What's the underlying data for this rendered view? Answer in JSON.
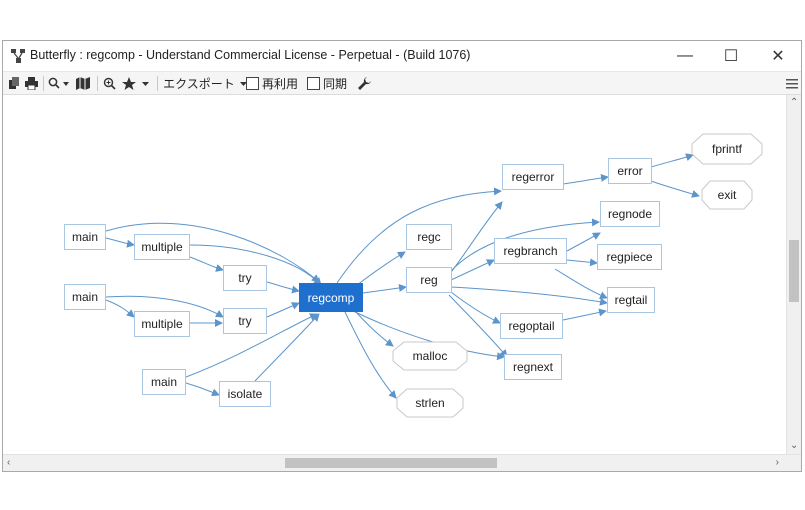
{
  "window": {
    "title": "Butterfly : regcomp - Understand Commercial License - Perpetual - (Build 1076)",
    "minimize_glyph": "—",
    "maximize_glyph": "☐",
    "close_glyph": "✕"
  },
  "toolbar": {
    "export_label": "エクスポート",
    "reuse_label": "再利用",
    "sync_label": "同期",
    "reuse_checked": false,
    "sync_checked": false
  },
  "graph": {
    "nodes": {
      "main1": "main",
      "multiple1": "multiple",
      "try1": "try",
      "main2": "main",
      "multiple2": "multiple",
      "try2": "try",
      "main3": "main",
      "isolate": "isolate",
      "regcomp": "regcomp",
      "regc": "regc",
      "reg": "reg",
      "malloc": "malloc",
      "strlen": "strlen",
      "regerror": "regerror",
      "regbranch": "regbranch",
      "regoptail": "regoptail",
      "regnext": "regnext",
      "error": "error",
      "regnode": "regnode",
      "regpiece": "regpiece",
      "regtail": "regtail",
      "fprintf": "fprintf",
      "exit": "exit"
    },
    "selected": "regcomp",
    "colors": {
      "edge": "#5b95cc",
      "selected_fill": "#1f6fcf",
      "node_border": "#a9c7e3",
      "ext_border": "#c9c9c9"
    }
  }
}
